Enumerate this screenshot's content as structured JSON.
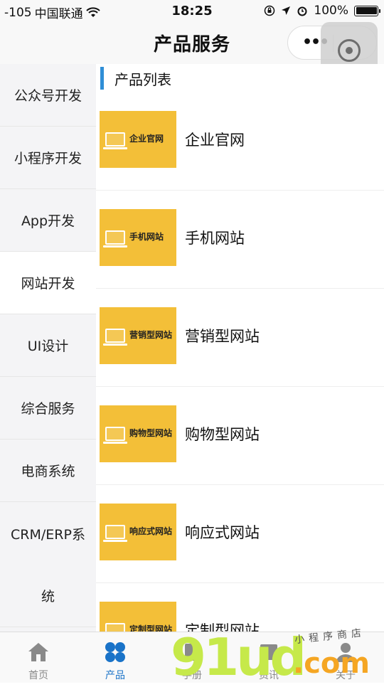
{
  "status_bar": {
    "signal": "-105",
    "carrier": "中国联通",
    "time": "18:25",
    "battery": "100%"
  },
  "nav": {
    "title": "产品服务",
    "more_label": "•••"
  },
  "sidebar": {
    "items": [
      {
        "label": "公众号开发",
        "active": false
      },
      {
        "label": "小程序开发",
        "active": false
      },
      {
        "label": "App开发",
        "active": false
      },
      {
        "label": "网站开发",
        "active": true
      },
      {
        "label": "UI设计",
        "active": false
      },
      {
        "label": "综合服务",
        "active": false
      },
      {
        "label": "电商系统",
        "active": false
      },
      {
        "label": "CRM/ERP系",
        "active": false
      },
      {
        "label": "统",
        "active": false
      }
    ]
  },
  "content": {
    "section_title": "产品列表",
    "products": [
      {
        "name": "企业官网",
        "thumb_text": "企业官网"
      },
      {
        "name": "手机网站",
        "thumb_text": "手机网站"
      },
      {
        "name": "营销型网站",
        "thumb_text": "营销型网站"
      },
      {
        "name": "购物型网站",
        "thumb_text": "购物型网站"
      },
      {
        "name": "响应式网站",
        "thumb_text": "响应式网站"
      },
      {
        "name": "定制型网站",
        "thumb_text": "定制型网站"
      }
    ]
  },
  "tab_bar": {
    "tabs": [
      {
        "label": "首页",
        "icon": "home-icon",
        "active": false
      },
      {
        "label": "产品",
        "icon": "grid-icon",
        "active": true
      },
      {
        "label": "手册",
        "icon": "book-icon",
        "active": false
      },
      {
        "label": "资讯",
        "icon": "news-icon",
        "active": false
      },
      {
        "label": "关于",
        "icon": "person-icon",
        "active": false
      }
    ]
  },
  "watermark": {
    "brand": "91ud",
    "domain": ".com",
    "slogan": "小程序商店"
  },
  "colors": {
    "accent": "#2f8ed6",
    "thumb_bg": "#f3bf38",
    "tab_active": "#1a73c8",
    "sidebar_bg": "#f4f4f6"
  }
}
